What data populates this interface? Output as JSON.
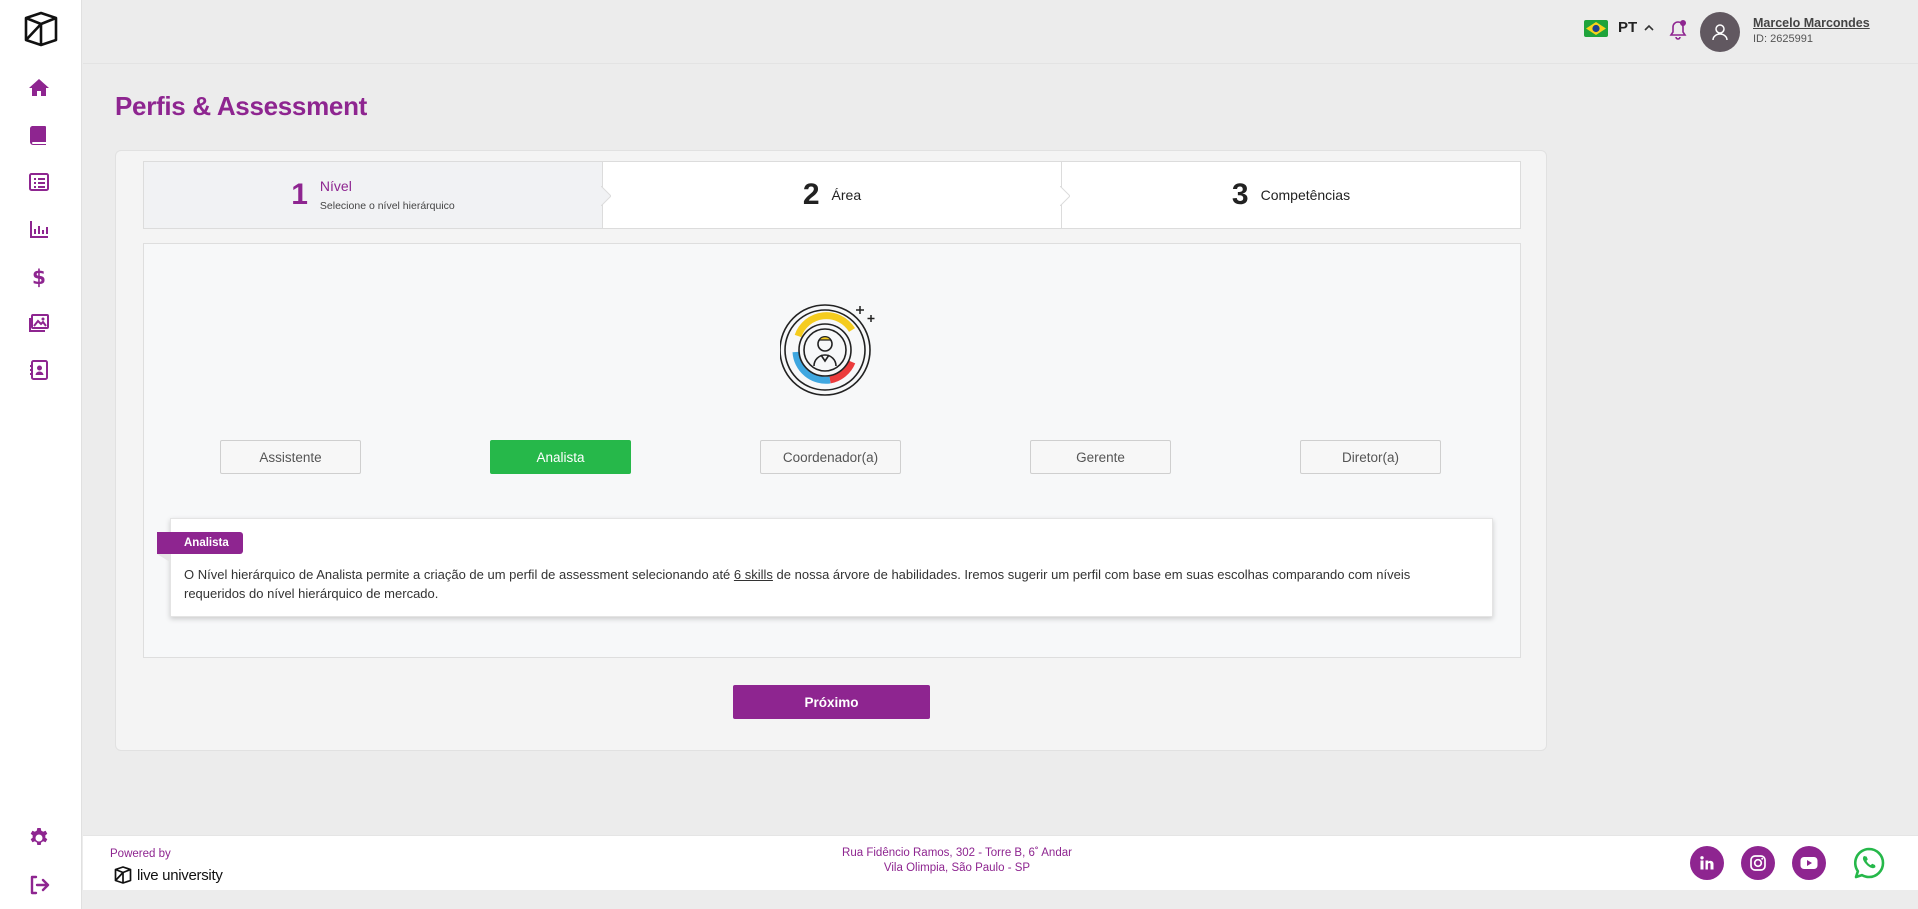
{
  "app": {
    "page_title": "Perfis & Assessment"
  },
  "header": {
    "language": "PT",
    "user_name": "Marcelo Marcondes",
    "user_id": "ID: 2625991"
  },
  "sidebar": {
    "items": [
      {
        "name": "home-icon"
      },
      {
        "name": "book-icon"
      },
      {
        "name": "list-icon"
      },
      {
        "name": "chart-icon"
      },
      {
        "name": "dollar-icon"
      },
      {
        "name": "images-icon"
      },
      {
        "name": "contact-book-icon"
      }
    ],
    "bottom": [
      {
        "name": "gear-icon"
      },
      {
        "name": "logout-icon"
      }
    ]
  },
  "stepper": {
    "steps": [
      {
        "number": "1",
        "label": "Nível",
        "sub": "Selecione o nível hierárquico",
        "active": true
      },
      {
        "number": "2",
        "label": "Área",
        "sub": "",
        "active": false
      },
      {
        "number": "3",
        "label": "Competências",
        "sub": "",
        "active": false
      }
    ]
  },
  "levels": {
    "options": [
      "Assistente",
      "Analista",
      "Coordenador(a)",
      "Gerente",
      "Diretor(a)"
    ],
    "selected": "Analista"
  },
  "info": {
    "tag": "Analista",
    "text_before": "O Nível hierárquico de Analista permite a criação de um perfil de assessment selecionando até ",
    "text_link": "6 skills",
    "text_after": " de nossa árvore de habilidades. Iremos sugerir um perfil com base em suas escolhas comparando com níveis requeridos do nível hierárquico de mercado."
  },
  "actions": {
    "next_label": "Próximo"
  },
  "footer": {
    "powered_by": "Powered by",
    "brand": "live university",
    "address_line1": "Rua Fidêncio Ramos, 302 - Torre B, 6˚ Andar",
    "address_line2": "Vila Olimpia, São Paulo - SP",
    "social": [
      "linkedin-icon",
      "instagram-icon",
      "youtube-icon",
      "whatsapp-icon"
    ]
  },
  "colors": {
    "brand_purple": "#8e2590",
    "selected_green": "#26b84a"
  }
}
